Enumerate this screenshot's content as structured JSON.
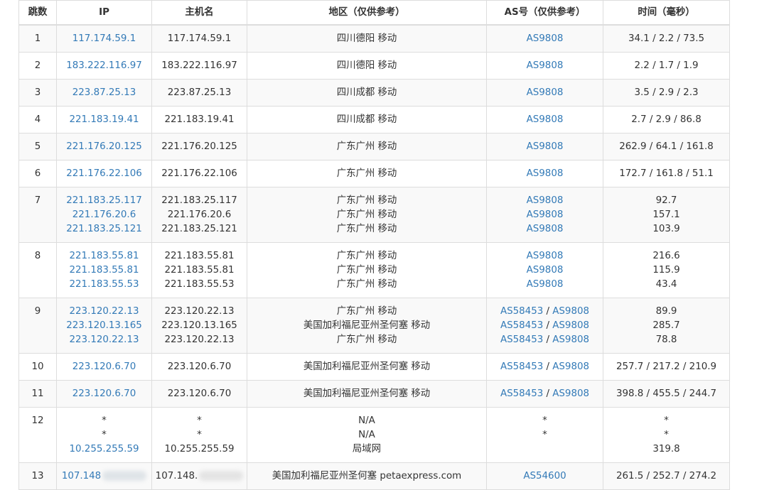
{
  "headers": [
    "跳数",
    "IP",
    "主机名",
    "地区（仅供参考）",
    "AS号（仅供参考）",
    "时间（毫秒）"
  ],
  "rows": [
    {
      "hop": "1",
      "ips": [
        "117.174.59.1"
      ],
      "hosts": [
        "117.174.59.1"
      ],
      "regions": [
        "四川德阳 移动"
      ],
      "as": [
        [
          "AS9808"
        ]
      ],
      "times": [
        "34.1 / 2.2 / 73.5"
      ]
    },
    {
      "hop": "2",
      "ips": [
        "183.222.116.97"
      ],
      "hosts": [
        "183.222.116.97"
      ],
      "regions": [
        "四川德阳 移动"
      ],
      "as": [
        [
          "AS9808"
        ]
      ],
      "times": [
        "2.2 / 1.7 / 1.9"
      ]
    },
    {
      "hop": "3",
      "ips": [
        "223.87.25.13"
      ],
      "hosts": [
        "223.87.25.13"
      ],
      "regions": [
        "四川成都 移动"
      ],
      "as": [
        [
          "AS9808"
        ]
      ],
      "times": [
        "3.5 / 2.9 / 2.3"
      ]
    },
    {
      "hop": "4",
      "ips": [
        "221.183.19.41"
      ],
      "hosts": [
        "221.183.19.41"
      ],
      "regions": [
        "四川成都 移动"
      ],
      "as": [
        [
          "AS9808"
        ]
      ],
      "times": [
        "2.7 / 2.9 / 86.8"
      ]
    },
    {
      "hop": "5",
      "ips": [
        "221.176.20.125"
      ],
      "hosts": [
        "221.176.20.125"
      ],
      "regions": [
        "广东广州 移动"
      ],
      "as": [
        [
          "AS9808"
        ]
      ],
      "times": [
        "262.9 / 64.1 / 161.8"
      ]
    },
    {
      "hop": "6",
      "ips": [
        "221.176.22.106"
      ],
      "hosts": [
        "221.176.22.106"
      ],
      "regions": [
        "广东广州 移动"
      ],
      "as": [
        [
          "AS9808"
        ]
      ],
      "times": [
        "172.7 / 161.8 / 51.1"
      ]
    },
    {
      "hop": "7",
      "ips": [
        "221.183.25.117",
        "221.176.20.6",
        "221.183.25.121"
      ],
      "hosts": [
        "221.183.25.117",
        "221.176.20.6",
        "221.183.25.121"
      ],
      "regions": [
        "广东广州 移动",
        "广东广州 移动",
        "广东广州 移动"
      ],
      "as": [
        [
          "AS9808"
        ],
        [
          "AS9808"
        ],
        [
          "AS9808"
        ]
      ],
      "times": [
        "92.7",
        "157.1",
        "103.9"
      ]
    },
    {
      "hop": "8",
      "ips": [
        "221.183.55.81",
        "221.183.55.81",
        "221.183.55.53"
      ],
      "hosts": [
        "221.183.55.81",
        "221.183.55.81",
        "221.183.55.53"
      ],
      "regions": [
        "广东广州 移动",
        "广东广州 移动",
        "广东广州 移动"
      ],
      "as": [
        [
          "AS9808"
        ],
        [
          "AS9808"
        ],
        [
          "AS9808"
        ]
      ],
      "times": [
        "216.6",
        "115.9",
        "43.4"
      ]
    },
    {
      "hop": "9",
      "ips": [
        "223.120.22.13",
        "223.120.13.165",
        "223.120.22.13"
      ],
      "hosts": [
        "223.120.22.13",
        "223.120.13.165",
        "223.120.22.13"
      ],
      "regions": [
        "广东广州 移动",
        "美国加利福尼亚州圣何塞 移动",
        "广东广州 移动"
      ],
      "as": [
        [
          "AS58453",
          "AS9808"
        ],
        [
          "AS58453",
          "AS9808"
        ],
        [
          "AS58453",
          "AS9808"
        ]
      ],
      "times": [
        "89.9",
        "285.7",
        "78.8"
      ]
    },
    {
      "hop": "10",
      "ips": [
        "223.120.6.70"
      ],
      "hosts": [
        "223.120.6.70"
      ],
      "regions": [
        "美国加利福尼亚州圣何塞 移动"
      ],
      "as": [
        [
          "AS58453",
          "AS9808"
        ]
      ],
      "times": [
        "257.7 / 217.2 / 210.9"
      ]
    },
    {
      "hop": "11",
      "ips": [
        "223.120.6.70"
      ],
      "hosts": [
        "223.120.6.70"
      ],
      "regions": [
        "美国加利福尼亚州圣何塞 移动"
      ],
      "as": [
        [
          "AS58453",
          "AS9808"
        ]
      ],
      "times": [
        "398.8 / 455.5 / 244.7"
      ]
    },
    {
      "hop": "12",
      "ips": [
        "*",
        "*",
        "10.255.255.59"
      ],
      "hosts": [
        "*",
        "*",
        "10.255.255.59"
      ],
      "regions": [
        "N/A",
        "N/A",
        "局域网"
      ],
      "as": [
        [
          "*"
        ],
        [
          "*"
        ],
        []
      ],
      "times": [
        "*",
        "*",
        "319.8"
      ]
    },
    {
      "hop": "13",
      "ips": [
        "107.148"
      ],
      "hosts": [
        "107.148."
      ],
      "regions": [
        "美国加利福尼亚州圣何塞 petaexpress.com"
      ],
      "as": [
        [
          "AS54600"
        ]
      ],
      "times": [
        "261.5 / 252.7 / 274.2"
      ],
      "redacted": true
    }
  ],
  "colors": {
    "link": "#337ab7",
    "border": "#dddddd",
    "stripe": "#f9f9f9",
    "text": "#333333"
  }
}
